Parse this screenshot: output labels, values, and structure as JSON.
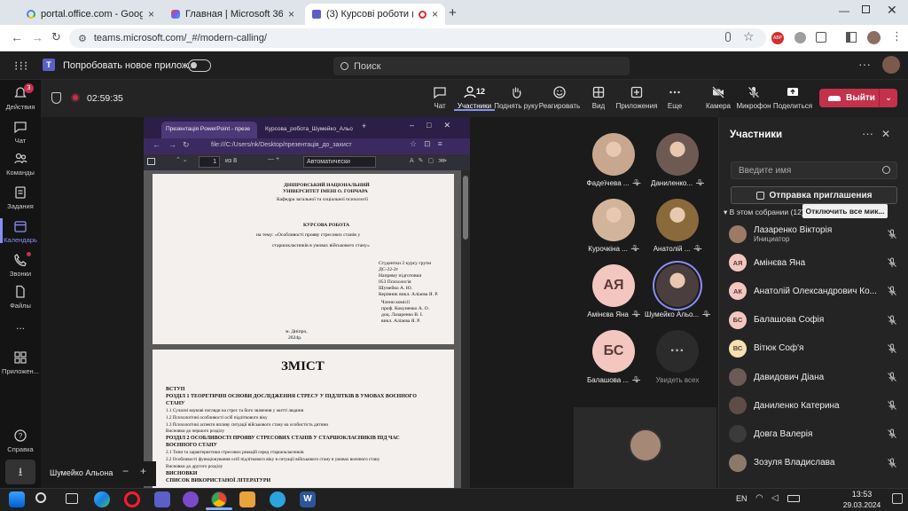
{
  "browser": {
    "tabs": [
      {
        "title": "portal.office.com - Google Sear",
        "icon": "google-g-icon"
      },
      {
        "title": "Главная | Microsoft 365",
        "icon": "m365-icon"
      },
      {
        "title": "(3) Курсові роботи (захист",
        "icon": "teams-icon"
      }
    ],
    "url": "teams.microsoft.com/_#/modern-calling/"
  },
  "teams": {
    "try_new": "Попробовать новое прилож...",
    "search_placeholder": "Поиск"
  },
  "rail": [
    {
      "label": "Действия",
      "badge": "3"
    },
    {
      "label": "Чат"
    },
    {
      "label": "Команды"
    },
    {
      "label": "Задания"
    },
    {
      "label": "Календарь",
      "active": true
    },
    {
      "label": "Звонки"
    },
    {
      "label": "Файлы"
    },
    {
      "label": "..."
    },
    {
      "label": "Приложен..."
    },
    {
      "label": "Справка"
    }
  ],
  "meeting": {
    "timer": "02:59:35",
    "toolbar": {
      "chat": "Чат",
      "participants": "Участники",
      "participants_count": "12",
      "raise_hand": "Поднять руку",
      "react": "Реагировать",
      "view": "Вид",
      "apps": "Приложения",
      "more": "Еще",
      "camera": "Камера",
      "mic": "Микрофон",
      "share": "Поделиться",
      "leave": "Выйти"
    },
    "presenter_name": "Шумейко Альона"
  },
  "shared": {
    "tabs": [
      "Презентація PowerPoint - презе",
      "Курсова_робота_Шумейко_Альо"
    ],
    "url": "file:///C:/Users/nk/Desktop/презентація_до_захист",
    "page_num": "1",
    "page_total": "из 8",
    "zoom": "Автоматически",
    "title_page": {
      "uni1": "ДНІПРОВСЬКИЙ НАЦІОНАЛЬНИЙ",
      "uni2": "УНІВЕРСИТЕТ ІМЕНІ О. ГОНЧАРА",
      "dept": "Кафедра загальної та соціальної психології",
      "work": "КУРСОВА РОБОТА",
      "topic1": "на тему: «Особливості прояву стресових станів у",
      "topic2": "старшокласників в умовах військового стану»",
      "s1": "Студентки 2 курсу групи",
      "s2": "ДС-22-2т",
      "s3": "Напряму підготовки",
      "s4": "053 Психологія",
      "s5": "Шумейко А. Ю.",
      "s6": "Керівник викл. Аліаєва Я. Р.",
      "c1": "Члени комісії",
      "c2": "проф. Кокуненко А. О.",
      "c3": "доц. Лазаренко В. І.",
      "c4": "викл. Аліаєва Я. Р.",
      "city": "м. Дніпро,",
      "year": "2024р."
    },
    "toc": {
      "title": "ЗМІСТ",
      "lines": [
        "ВСТУП",
        "РОЗДІЛ 1 ТЕОРЕТИЧНІ ОСНОВИ ДОСЛІДЖЕННЯ СТРЕСУ У ПІДЛІТКІВ В УМОВАХ ВОЄННОГО",
        "СТАНУ",
        "1.1 Сучасні наукові погляди на стрес та його значення у житті людини",
        "1.2 Психологічні особливості осіб підліткового віку",
        "1.3 Психологічні аспекти впливу ситуації військового стану на особистість дитини",
        "Висновки до першого розділу",
        "РОЗДІЛ 2 ОСОБЛИВОСТІ ПРОЯВУ СТРЕСОВИХ СТАНІВ У СТАРШОКЛАСНИКІВ ПІД ЧАС",
        "ВОЄННОГО СТАНУ",
        "2.1 Типи та характеристики стресових реакцій серед старшокласників",
        "2.2 Особливості функціонування осіб підліткового віку в ситуації військового стану в умовах воєнного стану",
        "Висновки до другого розділу",
        "ВИСНОВКИ",
        "СПИСОК ВИКОРИСТАНОЇ ЛІТЕРАТУРИ"
      ]
    }
  },
  "grid": [
    {
      "name": "Фадеїчева ...",
      "initials": "",
      "photo": true,
      "color": "#c9a78e"
    },
    {
      "name": "Даниленко...",
      "initials": "",
      "photo": true,
      "color": "#6e5a52"
    },
    {
      "name": "Курочкіна ...",
      "initials": "",
      "photo": true,
      "color": "#d2b49a"
    },
    {
      "name": "Анатолій ...",
      "initials": "",
      "photo": true,
      "color": "#8a6a3a"
    },
    {
      "name": "Амінєва Яна",
      "initials": "АЯ",
      "photo": false,
      "color": "#f3c7bf"
    },
    {
      "name": "Шумейко Альо...",
      "initials": "",
      "photo": true,
      "color": "#4a3e3e"
    },
    {
      "name": "Балашова ...",
      "initials": "БС",
      "photo": false,
      "color": "#f3c7bf"
    },
    {
      "name": "Увидеть всех",
      "initials": "···",
      "photo": false,
      "color": "#2b2b2b"
    }
  ],
  "panel": {
    "title": "Участники",
    "search_placeholder": "Введите имя",
    "invite": "Отправка приглашения",
    "in_meeting": "В этом собрании (12)",
    "mute_all": "Отключить все мик...",
    "people": [
      {
        "name": "Лазаренко Вікторія",
        "role": "Инициатор",
        "initials": "",
        "color": "#9b7b66"
      },
      {
        "name": "Амінєва Яна",
        "initials": "АЯ",
        "color": "#f3c7bf"
      },
      {
        "name": "Анатолій Олександрович Ко...",
        "initials": "АК",
        "color": "#f3c7bf"
      },
      {
        "name": "Балашова Софія",
        "initials": "БС",
        "color": "#f3c7bf"
      },
      {
        "name": "Вітюк Соф'я",
        "initials": "ВС",
        "color": "#f5e0b0"
      },
      {
        "name": "Давидович Діана",
        "initials": "",
        "color": "#6b5a55"
      },
      {
        "name": "Даниленко Катерина",
        "initials": "",
        "color": "#5d4c48"
      },
      {
        "name": "Довга Валерія",
        "initials": "",
        "color": "#3b3b3b"
      },
      {
        "name": "Зозуля Владислава",
        "initials": "",
        "color": "#8a7a6a"
      }
    ]
  },
  "taskbar": {
    "lang": "EN",
    "time": "13:53",
    "date": "29.03.2024"
  }
}
